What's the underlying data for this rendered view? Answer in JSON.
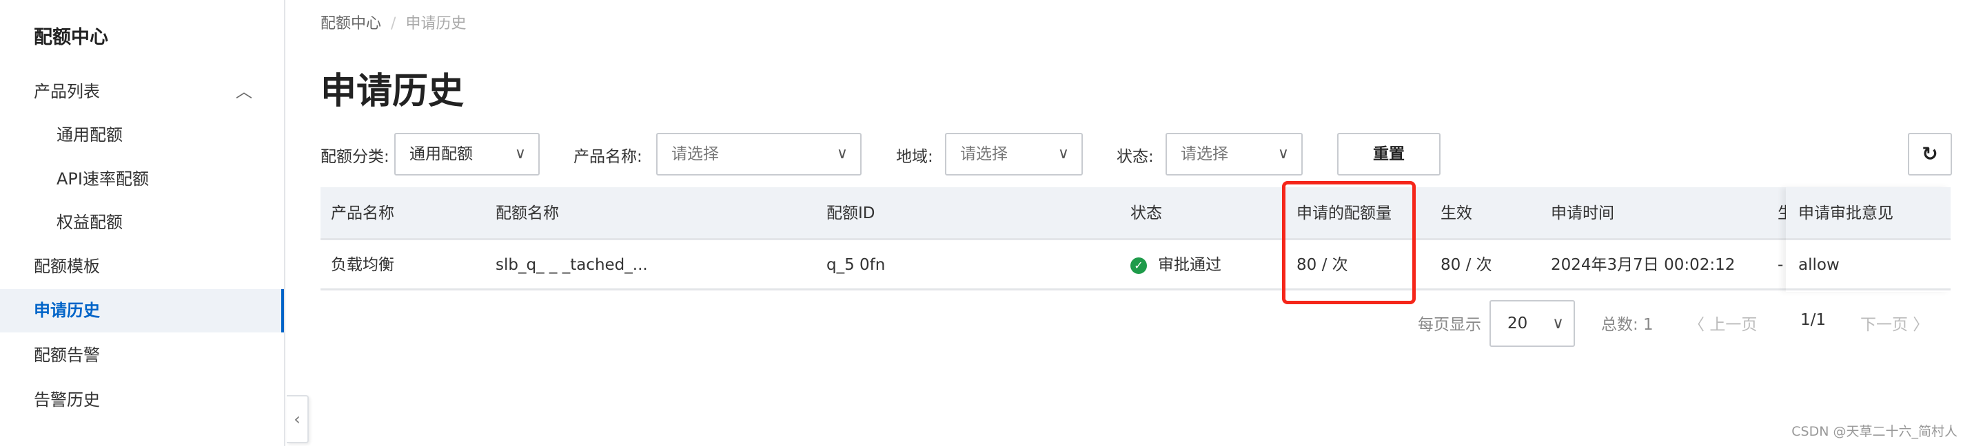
{
  "sidebar": {
    "title": "配额中心",
    "items": [
      {
        "label": "产品列表",
        "expanded": true
      },
      {
        "label": "通用配额"
      },
      {
        "label": "API速率配额"
      },
      {
        "label": "权益配额"
      },
      {
        "label": "配额模板"
      },
      {
        "label": "申请历史",
        "active": true
      },
      {
        "label": "配额告警"
      },
      {
        "label": "告警历史"
      }
    ]
  },
  "breadcrumb": [
    "配额中心",
    "申请历史"
  ],
  "page_title": "申请历史",
  "filters": {
    "category": {
      "label": "配额分类:",
      "value": "通用配额"
    },
    "product": {
      "label": "产品名称:",
      "placeholder": "请选择"
    },
    "region": {
      "label": "地域:",
      "placeholder": "请选择"
    },
    "status": {
      "label": "状态:",
      "placeholder": "请选择"
    },
    "reset": "重置"
  },
  "table": {
    "headers": [
      "产品名称",
      "配额名称",
      "配额ID",
      "状态",
      "申请的配额量",
      "生效",
      "申请时间",
      "生",
      "申请审批意见"
    ],
    "rows": [
      [
        "负载均衡",
        "slb_q_ _ _tached_...",
        "q_5 0fn",
        "审批通过",
        "80 / 次",
        "80 / 次",
        "2024年3月7日 00:02:12",
        "-",
        "allow"
      ]
    ]
  },
  "pagination": {
    "per_page_label": "每页显示",
    "per_page": "20",
    "total": "总数: 1",
    "prev": "上一页",
    "page": "1/1",
    "next": "下一页"
  },
  "watermark": "CSDN @天草二十六_简村人",
  "colors": {
    "accent": "#0064c8",
    "highlight": "#f5261a",
    "success": "#1e9b4a"
  }
}
